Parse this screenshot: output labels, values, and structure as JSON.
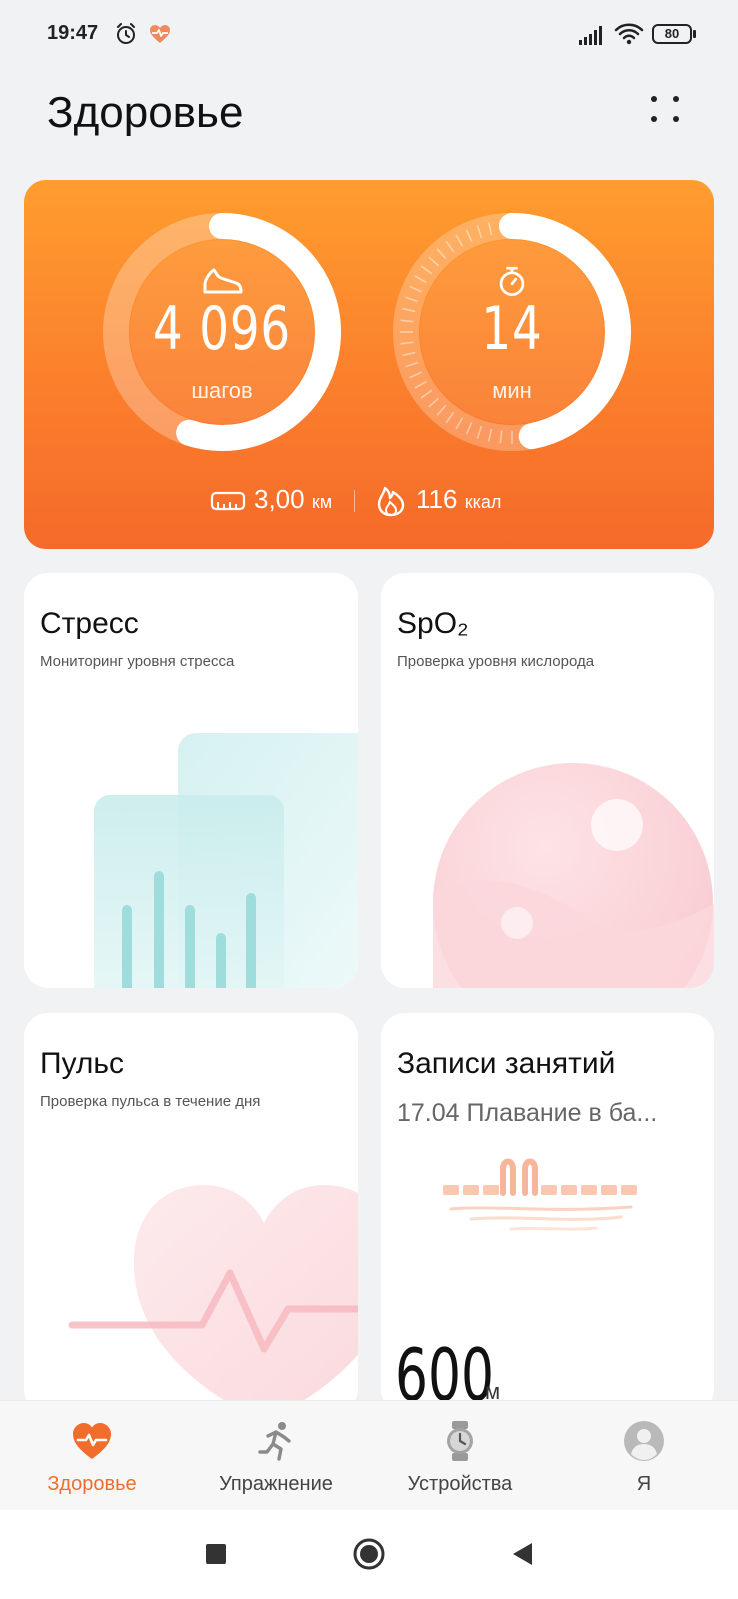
{
  "status_bar": {
    "time": "19:47",
    "battery": "80",
    "icons": [
      "alarm-icon",
      "heart-rate-icon",
      "signal-icon",
      "wifi-icon",
      "battery-icon"
    ]
  },
  "header": {
    "title": "Здоровье",
    "menu_icon": "four-dots-icon"
  },
  "activity": {
    "steps_value": "4 096",
    "steps_unit": "шагов",
    "steps_progress": 0.55,
    "minutes_value": "14",
    "minutes_unit": "мин",
    "minutes_progress": 0.47,
    "distance_value": "3,00",
    "distance_unit": "км",
    "calories_value": "116",
    "calories_unit": "ккал",
    "colors": {
      "gradient_top": "#ff9d2f",
      "gradient_bottom": "#f56a2a"
    }
  },
  "cards": {
    "stress": {
      "title": "Стресс",
      "subtitle": "Мониторинг уровня стресса"
    },
    "spo2": {
      "title": "SpO₂",
      "subtitle": "Проверка уровня кислорода"
    },
    "pulse": {
      "title": "Пульс",
      "subtitle": "Проверка пульса в течение дня"
    },
    "workout": {
      "title": "Записи занятий",
      "subtitle": "17.04 Плавание в ба...",
      "value": "600",
      "unit": "м"
    }
  },
  "bottom_nav": {
    "items": [
      {
        "label": "Здоровье",
        "icon": "heart-pulse-icon",
        "active": true
      },
      {
        "label": "Упражнение",
        "icon": "running-icon",
        "active": false
      },
      {
        "label": "Устройства",
        "icon": "watch-icon",
        "active": false
      },
      {
        "label": "Я",
        "icon": "profile-avatar-icon",
        "active": false
      }
    ],
    "accent_color": "#f26d2b"
  },
  "system_nav": [
    "recents-button",
    "home-button",
    "back-button"
  ]
}
